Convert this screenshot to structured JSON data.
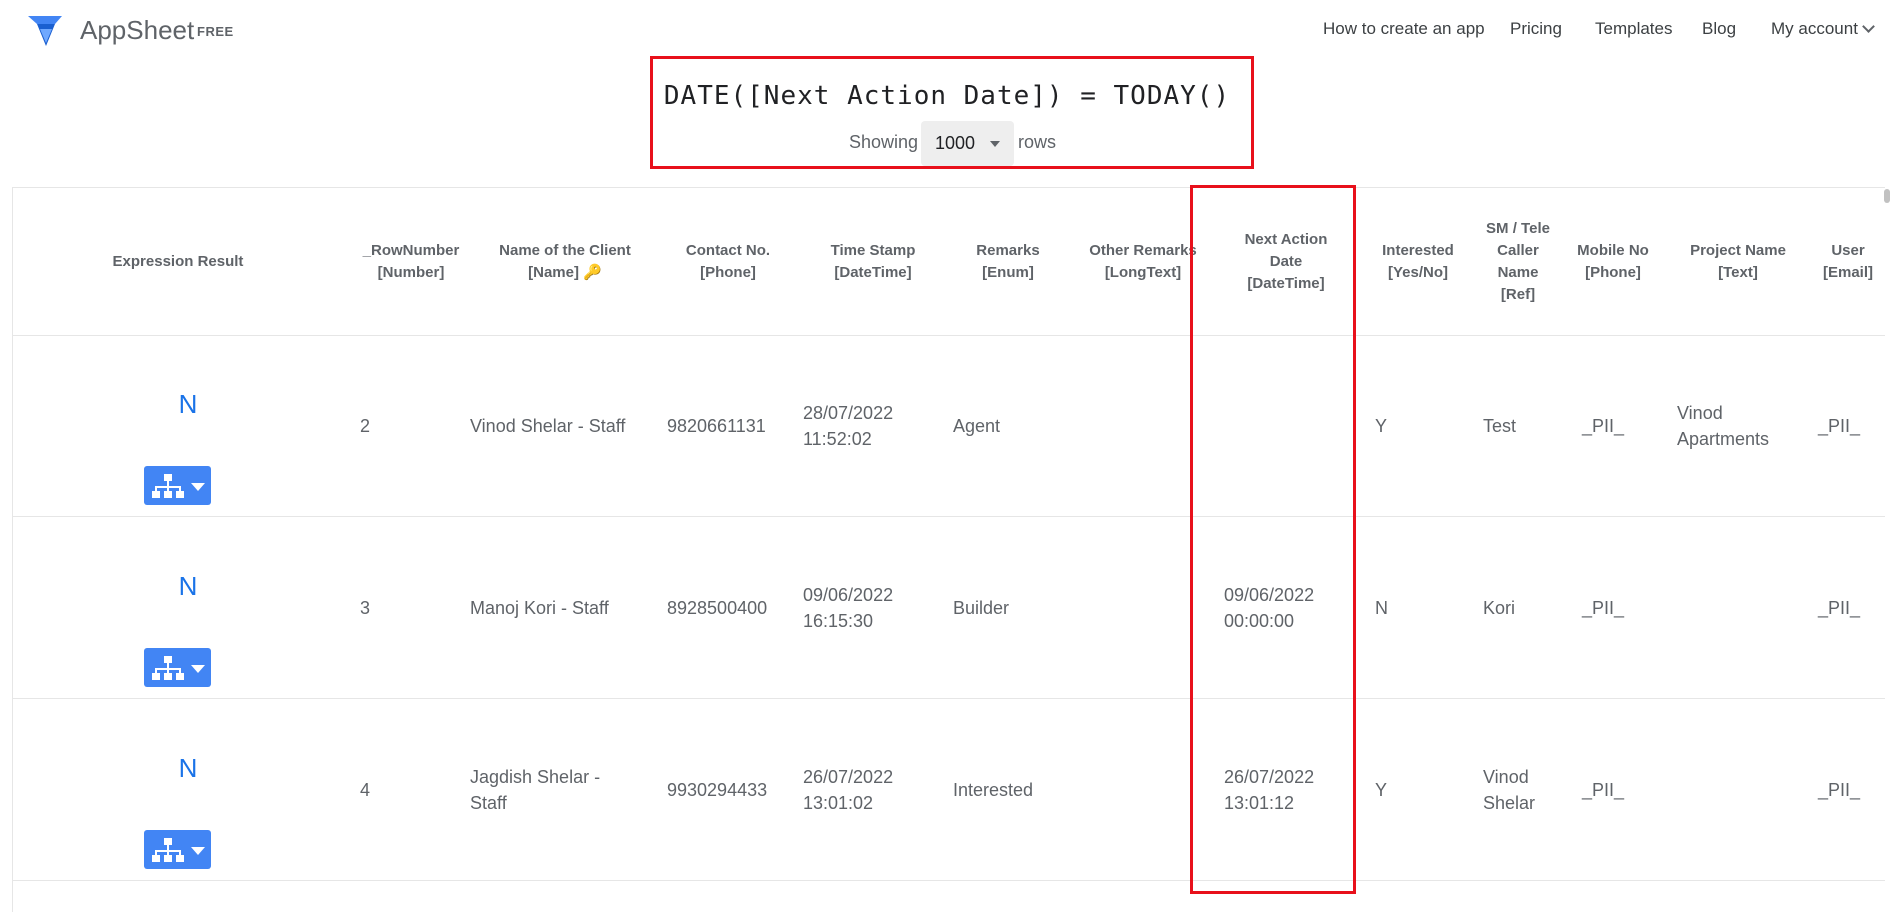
{
  "app": {
    "name": "AppSheet",
    "plan_badge": "FREE"
  },
  "nav": {
    "items": [
      "How to create an app",
      "Pricing",
      "Templates",
      "Blog"
    ],
    "account_label": "My account"
  },
  "expression": {
    "text": "DATE([Next Action Date]) = TODAY()",
    "showing_label": "Showing",
    "rows_label": "rows",
    "row_limit": "1000"
  },
  "table": {
    "columns": [
      {
        "name": "Expression Result",
        "type": ""
      },
      {
        "name": "_RowNumber",
        "type": "[Number]"
      },
      {
        "name": "Name of the Client",
        "type": "[Name] 🔑"
      },
      {
        "name": "Contact No.",
        "type": "[Phone]"
      },
      {
        "name": "Time Stamp",
        "type": "[DateTime]"
      },
      {
        "name": "Remarks",
        "type": "[Enum]"
      },
      {
        "name": "Other Remarks",
        "type": "[LongText]"
      },
      {
        "name": "Next Action Date",
        "type": "[DateTime]"
      },
      {
        "name": "Interested",
        "type": "[Yes/No]"
      },
      {
        "name": "SM / Tele Caller Name",
        "type": "[Ref]"
      },
      {
        "name": "Mobile No",
        "type": "[Phone]"
      },
      {
        "name": "Project Name",
        "type": "[Text]"
      },
      {
        "name": "User",
        "type": "[Email]"
      }
    ],
    "rows": [
      {
        "result": "N",
        "row_number": "2",
        "client": "Vinod Shelar - Staff",
        "contact": "9820661131",
        "timestamp": "28/07/2022 11:52:02",
        "remarks": "Agent",
        "other_remarks": "",
        "next_action": "",
        "interested": "Y",
        "caller": "Test",
        "mobile": "_PII_",
        "project": "Vinod Apartments",
        "user": "_PII_"
      },
      {
        "result": "N",
        "row_number": "3",
        "client": "Manoj Kori - Staff",
        "contact": "8928500400",
        "timestamp": "09/06/2022 16:15:30",
        "remarks": "Builder",
        "other_remarks": "",
        "next_action": "09/06/2022 00:00:00",
        "interested": "N",
        "caller": "Kori",
        "mobile": "_PII_",
        "project": "",
        "user": "_PII_"
      },
      {
        "result": "N",
        "row_number": "4",
        "client": "Jagdish Shelar - Staff",
        "contact": "9930294433",
        "timestamp": "26/07/2022 13:01:02",
        "remarks": "Interested",
        "other_remarks": "",
        "next_action": "26/07/2022 13:01:12",
        "interested": "Y",
        "caller": "Vinod Shelar",
        "mobile": "_PII_",
        "project": "",
        "user": "_PII_"
      }
    ]
  },
  "colors": {
    "accent": "#4285f4",
    "result_text": "#1a73e8",
    "highlight": "#e8101b"
  },
  "icons": {
    "logo": "appsheet-logo-icon",
    "action": "hierarchy-icon",
    "account_caret": "chevron-down-icon"
  }
}
